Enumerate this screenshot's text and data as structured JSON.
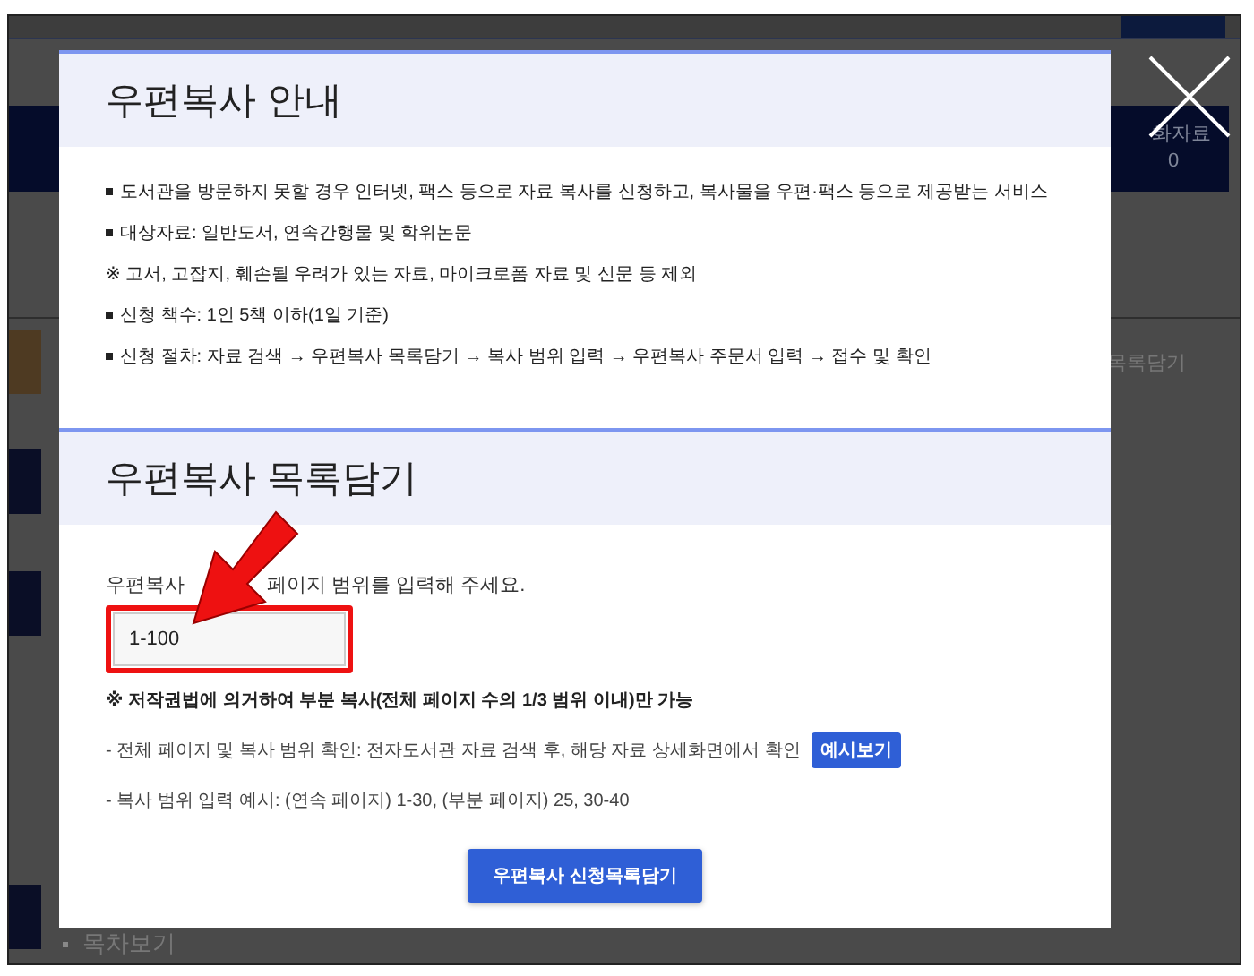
{
  "background": {
    "stat_label": "화자료",
    "stat_value": "0",
    "side_link": "목록담기",
    "toc_link": "목차보기"
  },
  "guide": {
    "title": "우편복사 안내",
    "items": [
      {
        "kind": "bullet",
        "text": "도서관을 방문하지 못할 경우 인터넷, 팩스 등으로 자료 복사를 신청하고, 복사물을 우편·팩스 등으로 제공받는 서비스"
      },
      {
        "kind": "bullet",
        "text": "대상자료: 일반도서, 연속간행물 및 학위논문"
      },
      {
        "kind": "note",
        "text": "※ 고서, 고잡지, 훼손될 우려가 있는 자료, 마이크로폼 자료 및 신문 등 제외"
      },
      {
        "kind": "bullet",
        "text": "신청 책수: 1인 5책 이하(1일 기준)"
      },
      {
        "kind": "bullet",
        "text": "신청 절차: 자료 검색 → 우편복사 목록담기 → 복사 범위 입력 → 우편복사 주문서 입력 → 접수 및 확인"
      }
    ]
  },
  "cart": {
    "title": "우편복사 목록담기",
    "prompt_parts": [
      "우편복사",
      "페이지 범위를 입력해 주세요."
    ],
    "range": {
      "value": "1-100"
    },
    "notes": [
      {
        "kind": "bold",
        "text": "※ 저작권법에 의거하여 부분 복사(전체 페이지 수의 1/3 범위 이내)만 가능"
      },
      {
        "kind": "plain",
        "text": "- 전체 페이지 및 복사 범위 확인: 전자도서관 자료 검색 후, 해당 자료 상세화면에서 확인",
        "button": "예시보기"
      },
      {
        "kind": "plain",
        "text": "- 복사 범위 입력 예시: (연속 페이지) 1-30, (부분 페이지) 25, 30-40"
      }
    ],
    "submit": "우편복사 신청목록담기"
  }
}
